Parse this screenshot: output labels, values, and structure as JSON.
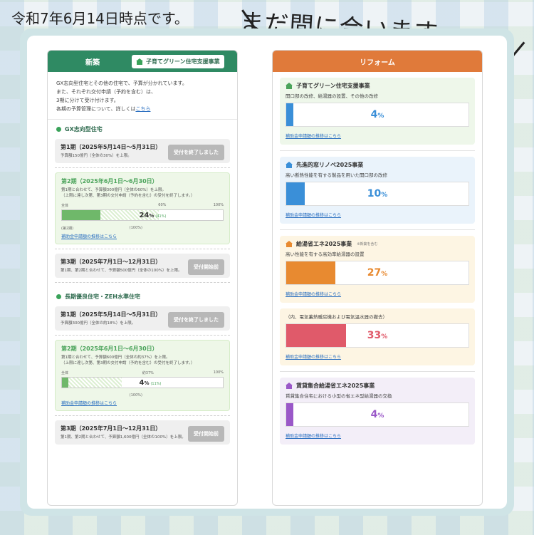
{
  "caption": "令和7年6月14日時点です。",
  "slogan": "まだ間に合います",
  "colors": {
    "green": "#2f8a63",
    "orange": "#e07a3a",
    "blue": "#3a8fd8",
    "red": "#e05a6a",
    "purple": "#9a58c8",
    "amber": "#e88a30"
  },
  "left": {
    "tab_new": "新築",
    "tab_program": "子育てグリーン住宅支援事業",
    "intro": [
      "GX志向型住宅とその他の住宅で、予算が分かれています。",
      "また、それぞれ交付申請（予約を含む）は、",
      "3期に分けて受け付けます。",
      "各期の予算管理について、詳しくは"
    ],
    "intro_link": "こちら",
    "groups": [
      {
        "label": "GX志向型住宅",
        "p1": {
          "title": "第1期（2025年5月14日〜5月31日）",
          "note": "予算額150億円（全体の30%）を上限。",
          "status": "受付を終了しました"
        },
        "p2": {
          "title": "第2期（2025年6月1日〜6月30日）",
          "note1": "第1期と合わせて、予算額300億円（全体の60%）を上限。",
          "note2": "（上限に達し次第、第3期の交付申請（予約を含む）の受付を終了します。）",
          "bar_left": "全体",
          "bar_mid": "60%",
          "bar_right": "100%",
          "percent": 24,
          "percent_label": "24",
          "percent_unit": "%",
          "quota_percent": 60,
          "sub_quota": "(41%)",
          "sub_left": "(第2期)",
          "sub_right": "(100%)",
          "link": "補助金申請額の推移はこちら"
        },
        "p3": {
          "title": "第3期（2025年7月1日〜12月31日）",
          "note": "第1期、第2期と合わせて、予算額500億円（全体の100%）を上限。",
          "status": "受付開始前"
        }
      },
      {
        "label": "長期優良住宅・ZEH水準住宅",
        "p1": {
          "title": "第1期（2025年5月14日〜5月31日）",
          "note": "予算額300億円（全体の約18%）を上限。",
          "status": "受付を終了しました"
        },
        "p2": {
          "title": "第2期（2025年6月1日〜6月30日）",
          "note1": "第1期と合わせて、予算額600億円（全体の約37%）を上限。",
          "note2": "（上限に達し次第、第3期の交付申請（予約を含む）の受付を終了します。）",
          "bar_left": "全体",
          "bar_mid": "約37%",
          "bar_right": "100%",
          "percent": 4,
          "percent_label": "4",
          "percent_unit": "%",
          "quota_percent": 37,
          "sub_quota": "(11%)",
          "sub_left": "",
          "sub_right": "(100%)",
          "link": "補助金申請額の推移はこちら"
        },
        "p3": {
          "title": "第3期（2025年7月1日〜12月31日）",
          "note": "第1期、第2期と合わせて、予算額1,600億円（全体の100%）を上限。",
          "status": "受付開始前"
        }
      }
    ]
  },
  "right": {
    "header": "リフォーム",
    "cards": [
      {
        "title": "子育てグリーン住宅支援事業",
        "note": "",
        "desc": "開口部の改修、給湯器の設置、その他の改修",
        "percent": 4,
        "percent_label": "4",
        "unit": "%",
        "color": "#3a8fd8",
        "link": "補助金申請額の推移はこちら"
      },
      {
        "title": "先進的窓リノベ2025事業",
        "note": "",
        "desc": "高い断熱性能を有する製品を用いた開口部の改修",
        "percent": 10,
        "percent_label": "10",
        "unit": "%",
        "color": "#3a8fd8",
        "link": "補助金申請額の推移はこちら"
      },
      {
        "title": "給湯省エネ2025事業",
        "note": "※新築を含む",
        "desc": "高い性能を有する高効率給湯器の設置",
        "percent": 27,
        "percent_label": "27",
        "unit": "%",
        "color": "#e88a30",
        "link": "補助金申請額の推移はこちら"
      },
      {
        "title": "",
        "note": "",
        "desc": "（内、電気蓄熱暖房機および電気温水器の撤去）",
        "percent": 33,
        "percent_label": "33",
        "unit": "%",
        "color": "#e05a6a",
        "link": "補助金申請額の推移はこちら"
      },
      {
        "title": "賃貸集合給湯省エネ2025事業",
        "note": "",
        "desc": "賃貸集合住宅における小型の省エネ型給湯器の交換",
        "percent": 4,
        "percent_label": "4",
        "unit": "%",
        "color": "#9a58c8",
        "link": "補助金申請額の推移はこちら"
      }
    ]
  }
}
